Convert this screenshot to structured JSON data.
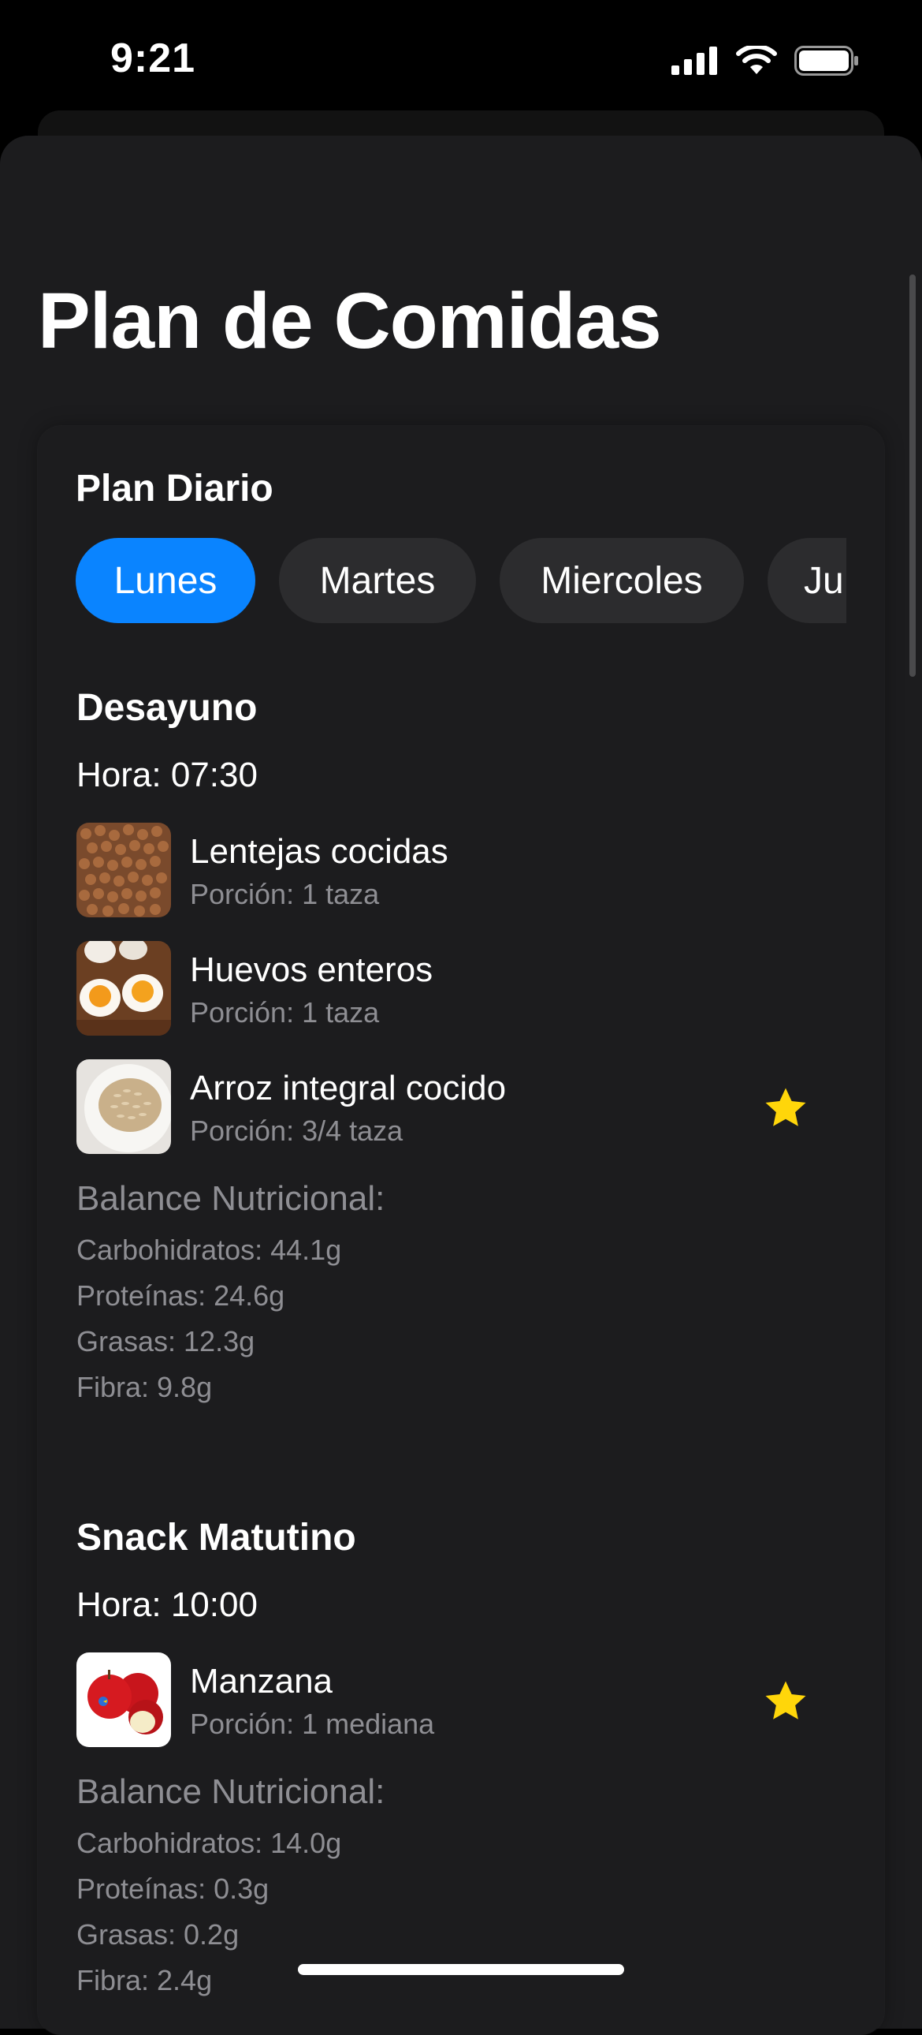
{
  "status": {
    "time": "9:21"
  },
  "page": {
    "title": "Plan de Comidas"
  },
  "plan": {
    "title": "Plan Diario",
    "days": [
      "Lunes",
      "Martes",
      "Miercoles",
      "Ju"
    ],
    "active_day": "Lunes"
  },
  "meals": [
    {
      "title": "Desayuno",
      "time": "Hora: 07:30",
      "foods": [
        {
          "name": "Lentejas cocidas",
          "portion": "Porción: 1 taza",
          "favorite": false,
          "image": "lentils-image"
        },
        {
          "name": "Huevos enteros",
          "portion": "Porción: 1 taza",
          "favorite": false,
          "image": "eggs-image"
        },
        {
          "name": "Arroz integral cocido",
          "portion": "Porción: 3/4 taza",
          "favorite": true,
          "image": "rice-image"
        }
      ],
      "nutrition": {
        "title": "Balance Nutricional:",
        "carbs": "Carbohidratos: 44.1g",
        "protein": "Proteínas: 24.6g",
        "fat": "Grasas: 12.3g",
        "fiber": "Fibra: 9.8g"
      }
    },
    {
      "title": "Snack Matutino",
      "time": "Hora: 10:00",
      "foods": [
        {
          "name": "Manzana",
          "portion": "Porción: 1 mediana",
          "favorite": true,
          "image": "apple-image"
        }
      ],
      "nutrition": {
        "title": "Balance Nutricional:",
        "carbs": "Carbohidratos: 14.0g",
        "protein": "Proteínas: 0.3g",
        "fat": "Grasas: 0.2g",
        "fiber": "Fibra: 2.4g"
      }
    }
  ],
  "colors": {
    "accent": "#0a84ff",
    "star": "#ffd60a",
    "background": "#1c1c1e",
    "pill": "#2c2c2e",
    "secondary_text": "#8e8e93"
  }
}
